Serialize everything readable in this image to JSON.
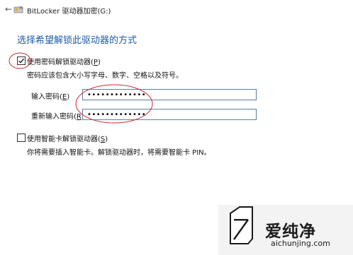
{
  "window": {
    "title": "BitLocker 驱动器加密(G:)",
    "back_icon": "back-arrow-icon",
    "app_icon": "bitlocker-drive-icon"
  },
  "heading": "选择希望解锁此驱动器的方式",
  "password_option": {
    "checked": true,
    "label_prefix": "使用密码解锁驱动器(",
    "access_key": "P",
    "label_suffix": ")",
    "hint": "密码应该包含大小写字母、数字、空格以及符号。",
    "enter_label_prefix": "输入密码(",
    "enter_access_key": "E",
    "enter_label_suffix": ")",
    "enter_value": "•••••••••••••",
    "reenter_label_prefix": "重新输入密码(",
    "reenter_access_key": "R",
    "reenter_label_suffix": ")",
    "reenter_value": "•••••••••••••"
  },
  "smartcard_option": {
    "checked": false,
    "label_prefix": "使用智能卡解锁驱动器(",
    "access_key": "S",
    "label_suffix": ")",
    "hint": "你将需要插入智能卡。解锁驱动器时，将需要智能卡 PIN。"
  },
  "watermark": {
    "brand": "爱纯净",
    "domain": "aichunjing.com"
  },
  "colors": {
    "heading": "#1e5da8",
    "annotation": "#d0262d",
    "field_border": "#5b7fa8"
  }
}
